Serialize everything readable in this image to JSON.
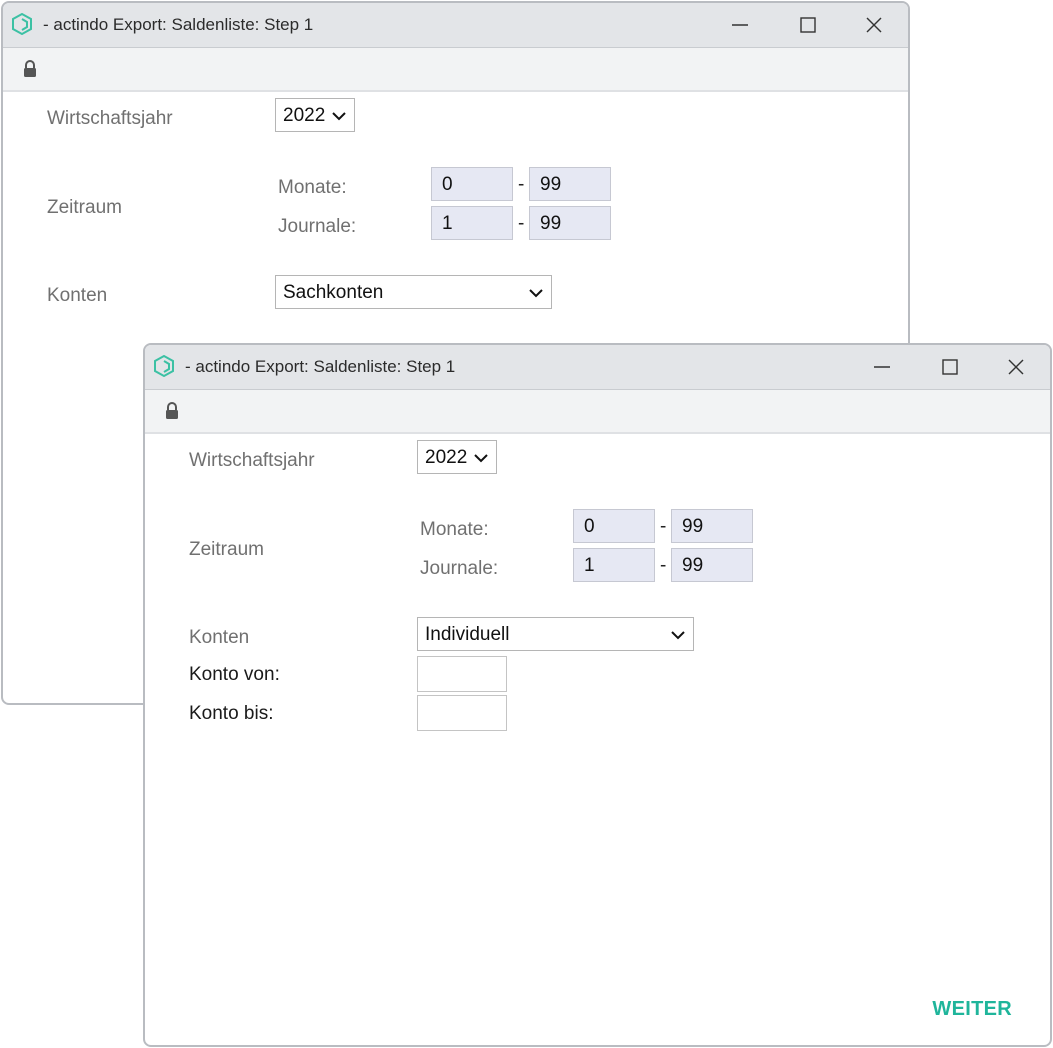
{
  "window1": {
    "title": "- actindo Export: Saldenliste: Step 1",
    "wirtschaftsjahr_label": "Wirtschaftsjahr",
    "year_value": "2022",
    "zeitraum_label": "Zeitraum",
    "monate_label": "Monate:",
    "monate_from": "0",
    "monate_to": "99",
    "journale_label": "Journale:",
    "journale_from": "1",
    "journale_to": "99",
    "range_separator": "-",
    "konten_label": "Konten",
    "konten_value": "Sachkonten"
  },
  "window2": {
    "title": "- actindo Export: Saldenliste: Step 1",
    "wirtschaftsjahr_label": "Wirtschaftsjahr",
    "year_value": "2022",
    "zeitraum_label": "Zeitraum",
    "monate_label": "Monate:",
    "monate_from": "0",
    "monate_to": "99",
    "journale_label": "Journale:",
    "journale_from": "1",
    "journale_to": "99",
    "range_separator": "-",
    "konten_label": "Konten",
    "konten_value": "Individuell",
    "konto_von_label": "Konto von:",
    "konto_von_value": "",
    "konto_bis_label": "Konto bis:",
    "konto_bis_value": "",
    "weiter_button": "WEITER"
  },
  "icons": {
    "app": "actindo-logo-icon",
    "minimize": "minimize-icon",
    "maximize": "maximize-icon",
    "close": "close-icon",
    "lock": "lock-icon",
    "dropdown": "chevron-down-icon"
  },
  "colors": {
    "accent": "#1fb59b",
    "titlebar": "#e3e5e8",
    "range_field": "#e6e8f3"
  }
}
